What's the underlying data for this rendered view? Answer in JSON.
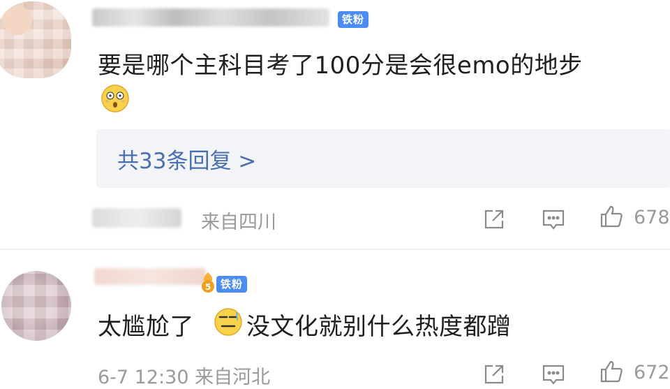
{
  "comments": [
    {
      "badge": "铁粉",
      "text": "要是哪个主科目考了100分是会很emo的地步",
      "emoji": "surprised-face",
      "replies_label": "共33条回复 >",
      "location": "来自四川",
      "likes": "678"
    },
    {
      "badge": "铁粉",
      "badge_level": "5",
      "text_before_emoji": "太尴尬了",
      "emoji": "awkward-face",
      "text_after_emoji": "没文化就别什么热度都蹭",
      "meta": "6-7 12:30  来自河北",
      "likes": "672"
    }
  ],
  "colors": {
    "badge": "#4b8df0",
    "link": "#4a6fb0",
    "meta": "#9a9a9a",
    "reply_box": "#f3f4f7"
  },
  "icons": [
    "share-icon",
    "comment-icon",
    "like-icon"
  ]
}
